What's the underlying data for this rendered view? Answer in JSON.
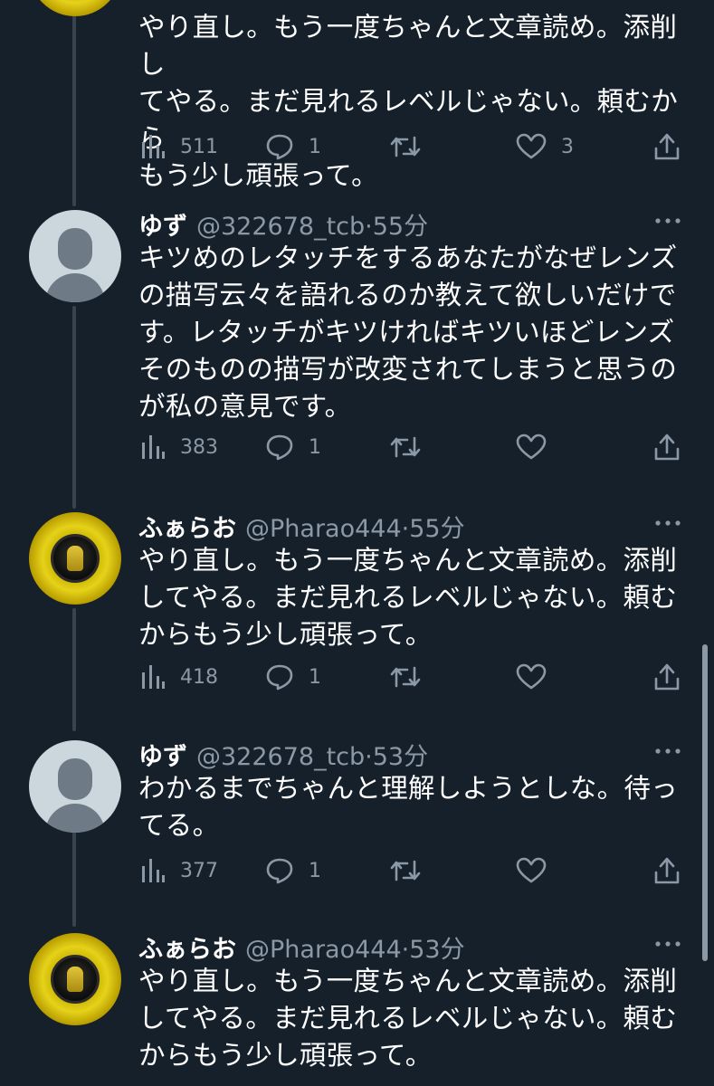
{
  "timeline": {
    "tweets": [
      {
        "name": "",
        "handle": "",
        "time": "",
        "text": "やり直し。もう一度ちゃんと文章読め。添削し\nてやる。まだ見れるレベルじゃない。頼むから\nもう少し頑張って。",
        "views": "511",
        "replies": "1",
        "retweets": "",
        "likes": "3"
      },
      {
        "name": "ゆず",
        "handle": "@322678_tcb",
        "dot": "·",
        "time": "55分",
        "text": "キツめのレタッチをするあなたがなぜレンズ\nの描写云々を語れるのか教えて欲しいだけで\nす。レタッチがキツければキツいほどレンズ\nそのものの描写が改変されてしまうと思うの\nが私の意見です。",
        "views": "383",
        "replies": "1",
        "retweets": "",
        "likes": ""
      },
      {
        "name": "ふぁらお",
        "handle": "@Pharao444",
        "dot": "·",
        "time": "55分",
        "text": "やり直し。もう一度ちゃんと文章読め。添削\nしてやる。まだ見れるレベルじゃない。頼む\nからもう少し頑張って。",
        "views": "418",
        "replies": "1",
        "retweets": "",
        "likes": ""
      },
      {
        "name": "ゆず",
        "handle": "@322678_tcb",
        "dot": "·",
        "time": "53分",
        "text": "わかるまでちゃんと理解しようとしな。待っ\nてる。",
        "views": "377",
        "replies": "1",
        "retweets": "",
        "likes": ""
      },
      {
        "name": "ふぁらお",
        "handle": "@Pharao444",
        "dot": "·",
        "time": "53分",
        "text": "やり直し。もう一度ちゃんと文章読め。添削\nしてやる。まだ見れるレベルじゃない。頼む\nからもう少し頑張って。",
        "views": "",
        "replies": "",
        "retweets": "",
        "likes": ""
      }
    ]
  },
  "icons": {
    "views": "bar-chart-icon",
    "reply": "speech-bubble-icon",
    "retweet": "retweet-icon",
    "like": "heart-icon",
    "share": "share-icon",
    "more": "more-dots-icon"
  },
  "colors": {
    "background": "#15202b",
    "text": "#ffffff",
    "secondary": "#8b98a5",
    "thread_line": "#38444d"
  }
}
